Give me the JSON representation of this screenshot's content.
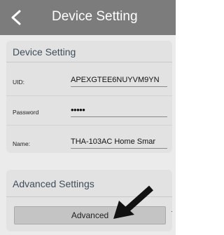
{
  "header": {
    "back_icon": "chevron-left-icon",
    "title": "Device Setting"
  },
  "device_card": {
    "title": "Device Setting",
    "rows": [
      {
        "label": "UID:",
        "value": "APEXGTEE6NUYVM9YN"
      },
      {
        "label": "Password",
        "value": "•••••"
      },
      {
        "label": "Name:",
        "value": "THA-103AC Home Smar"
      }
    ]
  },
  "advanced_card": {
    "title": "Advanced Settings",
    "button_label": "Advanced"
  },
  "annotation": {
    "arrow_icon": "pointer-arrow-icon",
    "color": "#111111"
  },
  "colors": {
    "header_bg": "#7c7c7c",
    "screen_bg": "#ebebeb",
    "card_bg": "#e2e2e2",
    "card_title": "#3f4d59"
  }
}
